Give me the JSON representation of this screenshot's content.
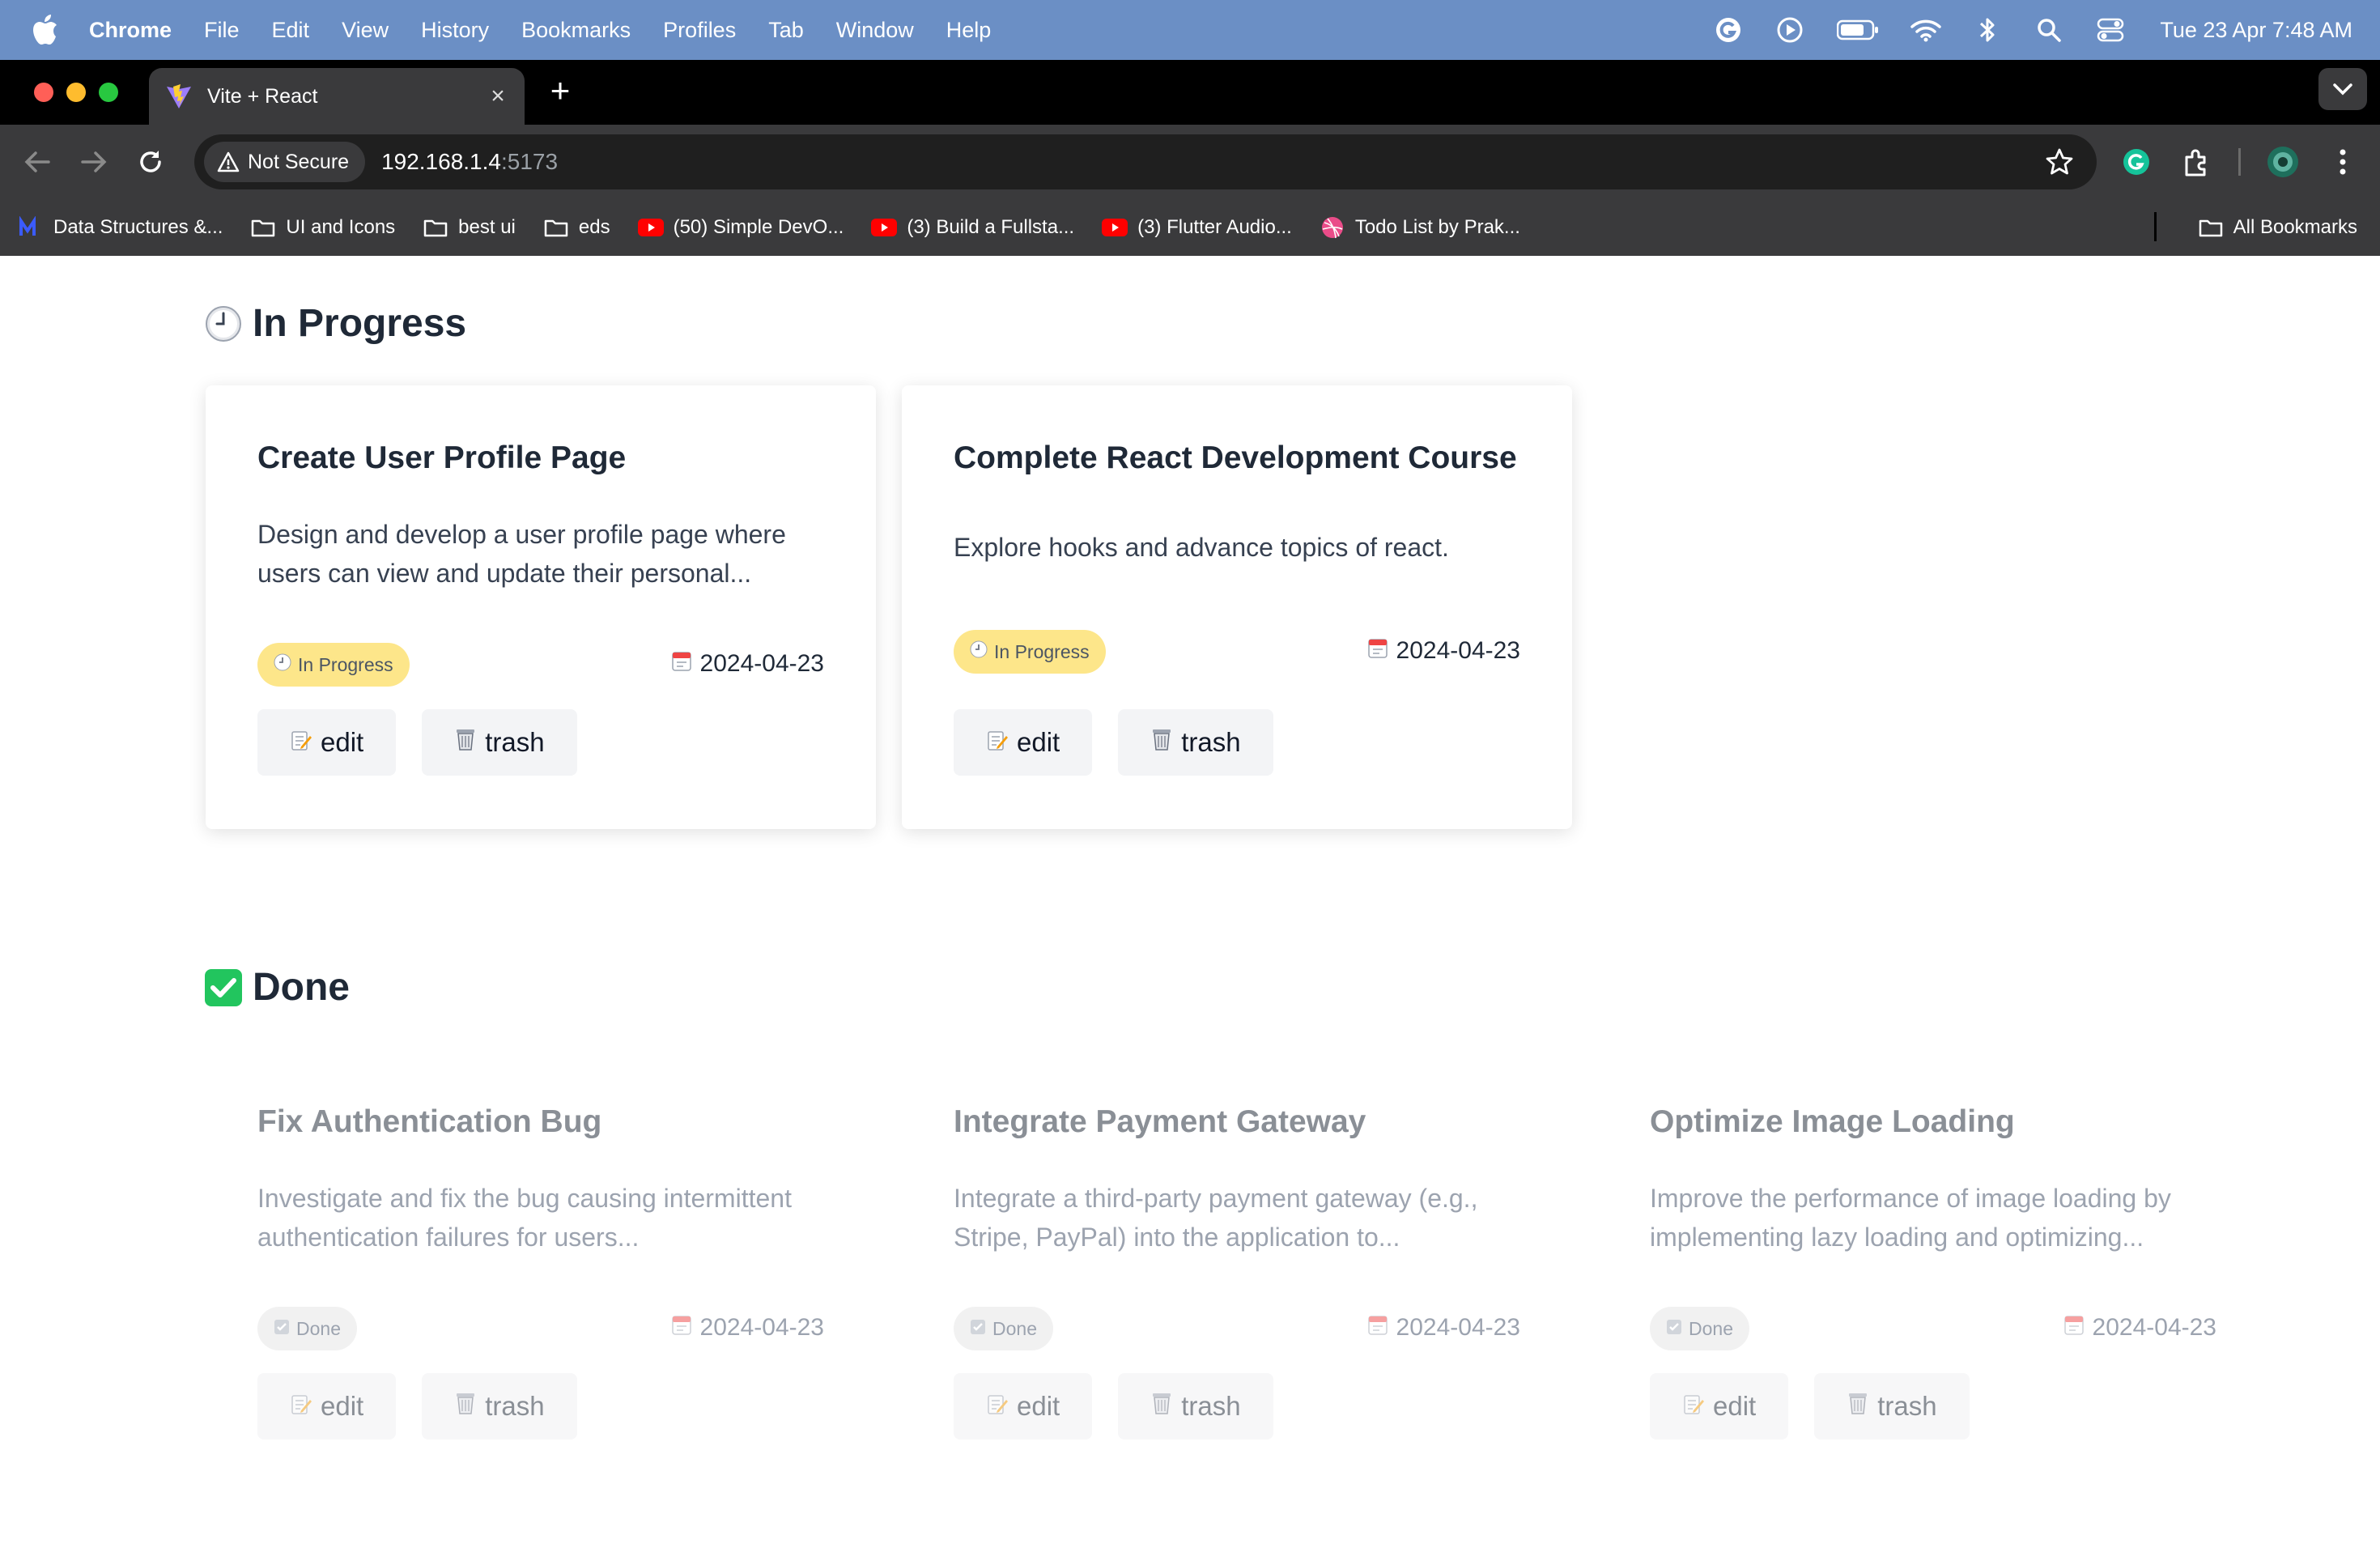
{
  "menubar": {
    "app_name": "Chrome",
    "items": [
      "File",
      "Edit",
      "View",
      "History",
      "Bookmarks",
      "Profiles",
      "Tab",
      "Window",
      "Help"
    ],
    "clock": "Tue 23 Apr  7:48 AM"
  },
  "tab": {
    "title": "Vite + React"
  },
  "toolbar": {
    "security_label": "Not Secure",
    "url_host": "192.168.1.4",
    "url_port": ":5173"
  },
  "bookmarks": {
    "items": [
      {
        "label": "Data Structures &...",
        "icon": "site-icon"
      },
      {
        "label": "UI and Icons",
        "icon": "folder-icon"
      },
      {
        "label": "best ui",
        "icon": "folder-icon"
      },
      {
        "label": "eds",
        "icon": "folder-icon"
      },
      {
        "label": "(50) Simple DevO...",
        "icon": "youtube-icon"
      },
      {
        "label": "(3) Build a Fullsta...",
        "icon": "youtube-icon"
      },
      {
        "label": "(3) Flutter Audio...",
        "icon": "youtube-icon"
      },
      {
        "label": "Todo List by Prak...",
        "icon": "dribbble-icon"
      }
    ],
    "all_label": "All Bookmarks"
  },
  "sections": {
    "in_progress": {
      "heading": "In Progress",
      "cards": [
        {
          "title": "Create User Profile Page",
          "description": "Design and develop a user profile page where users can view and update their personal...",
          "status": "In Progress",
          "date": "2024-04-23",
          "edit_label": "edit",
          "trash_label": "trash"
        },
        {
          "title": "Complete React Development Course",
          "description": "Explore hooks and advance topics of react.",
          "status": "In Progress",
          "date": "2024-04-23",
          "edit_label": "edit",
          "trash_label": "trash"
        }
      ]
    },
    "done": {
      "heading": "Done",
      "cards": [
        {
          "title": "Fix Authentication Bug",
          "description": "Investigate and fix the bug causing intermittent authentication failures for users...",
          "status": "Done",
          "date": "2024-04-23",
          "edit_label": "edit",
          "trash_label": "trash"
        },
        {
          "title": "Integrate Payment Gateway",
          "description": "Integrate a third-party payment gateway (e.g., Stripe, PayPal) into the application to...",
          "status": "Done",
          "date": "2024-04-23",
          "edit_label": "edit",
          "trash_label": "trash"
        },
        {
          "title": "Optimize Image Loading",
          "description": "Improve the performance of image loading by implementing lazy loading and optimizing...",
          "status": "Done",
          "date": "2024-04-23",
          "edit_label": "edit",
          "trash_label": "trash"
        }
      ]
    }
  },
  "colors": {
    "menubar": "#6b8fc5",
    "chrome_dark": "#3a3a3c",
    "badge_progress": "#fde68a",
    "badge_done": "#f1f1f1",
    "button_bg": "#f3f4f6"
  }
}
